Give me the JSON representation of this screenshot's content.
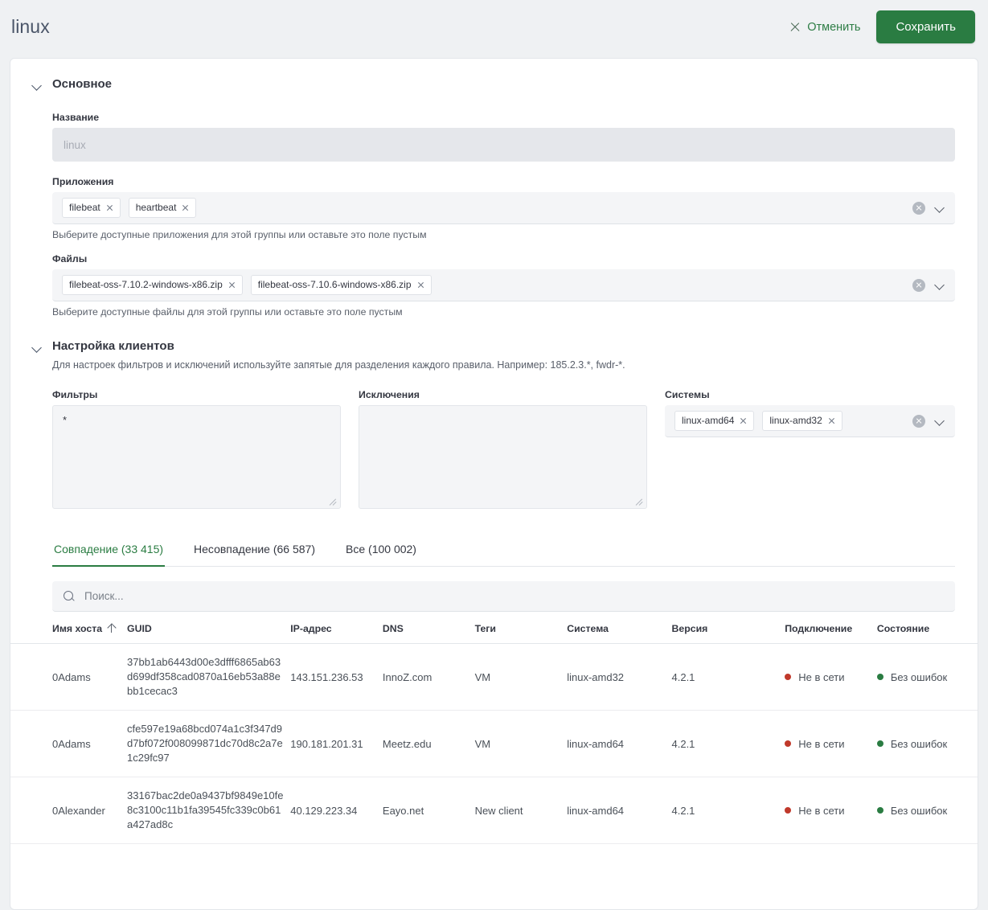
{
  "header": {
    "title": "linux",
    "cancel_label": "Отменить",
    "save_label": "Сохранить",
    "save_color": "#2a7c42"
  },
  "sections": {
    "general": {
      "title": "Основное",
      "name_label": "Название",
      "name_value": "linux",
      "apps_label": "Приложения",
      "apps_chips": [
        "filebeat",
        "heartbeat"
      ],
      "apps_hint": "Выберите доступные приложения для этой группы или оставьте это поле пустым",
      "files_label": "Файлы",
      "files_chips": [
        "filebeat-oss-7.10.2-windows-x86.zip",
        "filebeat-oss-7.10.6-windows-x86.zip"
      ],
      "files_hint": "Выберите доступные файлы для этой группы или оставьте это поле пустым"
    },
    "clients": {
      "title": "Настройка клиентов",
      "description": "Для настроек фильтров и исключений используйте запятые для разделения каждого правила. Например: 185.2.3.*, fwdr-*.",
      "filters_label": "Фильтры",
      "filters_value": "*",
      "exclusions_label": "Исключения",
      "exclusions_value": "",
      "systems_label": "Системы",
      "systems_chips": [
        "linux-amd64",
        "linux-amd32"
      ]
    }
  },
  "tabs": [
    {
      "label": "Совпадение (33 415)",
      "active": true
    },
    {
      "label": "Несовпадение (66 587)",
      "active": false
    },
    {
      "label": "Все (100 002)",
      "active": false
    }
  ],
  "search": {
    "placeholder": "Поиск..."
  },
  "table": {
    "columns": [
      "Имя хоста",
      "GUID",
      "IP-адрес",
      "DNS",
      "Теги",
      "Система",
      "Версия",
      "Подключение",
      "Состояние"
    ],
    "sorted_column": "Имя хоста",
    "sort_direction": "asc",
    "rows": [
      {
        "host": "0Adams",
        "guid": "37bb1ab6443d00e3dfff6865ab63d699df358cad0870a16eb53a88ebb1cecac3",
        "ip": "143.151.236.53",
        "dns": "InnoZ.com",
        "tags": "VM",
        "system": "linux-amd32",
        "version": "4.2.1",
        "connection": "Не в сети",
        "connection_color": "#c0392b",
        "state": "Без ошибок",
        "state_color": "#2a7c42"
      },
      {
        "host": "0Adams",
        "guid": "cfe597e19a68bcd074a1c3f347d9d7bf072f008099871dc70d8c2a7e1c29fc97",
        "ip": "190.181.201.31",
        "dns": "Meetz.edu",
        "tags": "VM",
        "system": "linux-amd64",
        "version": "4.2.1",
        "connection": "Не в сети",
        "connection_color": "#c0392b",
        "state": "Без ошибок",
        "state_color": "#2a7c42"
      },
      {
        "host": "0Alexander",
        "guid": "33167bac2de0a9437bf9849e10fe8c3100c11b1fa39545fc339c0b61a427ad8c",
        "ip": "40.129.223.34",
        "dns": "Eayo.net",
        "tags": "New client",
        "system": "linux-amd64",
        "version": "4.2.1",
        "connection": "Не в сети",
        "connection_color": "#c0392b",
        "state": "Без ошибок",
        "state_color": "#2a7c42"
      }
    ]
  }
}
